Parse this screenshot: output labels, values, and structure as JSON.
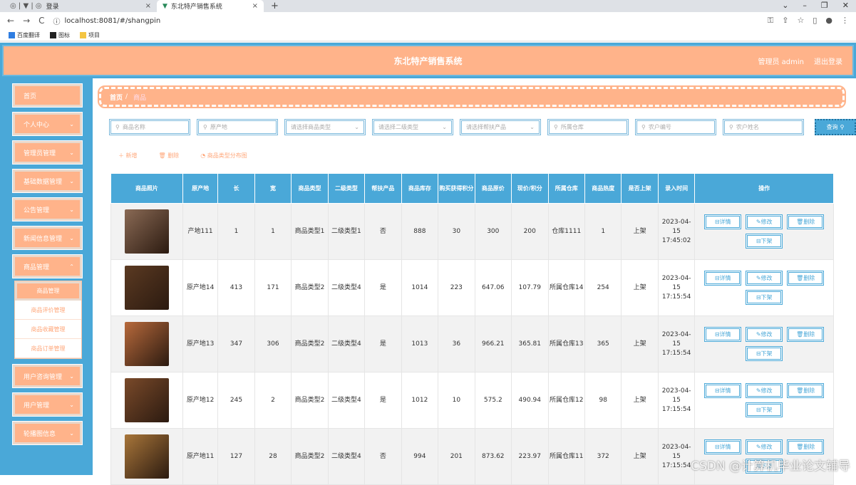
{
  "browser": {
    "tabs": [
      {
        "title": "登录"
      },
      {
        "title": "东北特产销售系统"
      }
    ],
    "url": "localhost:8081/#/shangpin",
    "bookmarks": [
      {
        "label": "百度翻译"
      },
      {
        "label": "图标"
      },
      {
        "label": "项目"
      }
    ]
  },
  "header": {
    "title": "东北特产销售系统",
    "user": "管理员 admin",
    "logout": "退出登录"
  },
  "sidebar": {
    "items": [
      {
        "label": "首页"
      },
      {
        "label": "个人中心"
      },
      {
        "label": "管理员管理"
      },
      {
        "label": "基础数据管理"
      },
      {
        "label": "公告管理"
      },
      {
        "label": "新闻信息管理"
      },
      {
        "label": "商品管理"
      }
    ],
    "submenu": [
      {
        "label": "商品管理"
      },
      {
        "label": "商品评价管理"
      },
      {
        "label": "商品收藏管理"
      },
      {
        "label": "商品订单管理"
      }
    ],
    "items_after": [
      {
        "label": "用户咨询管理"
      },
      {
        "label": "用户管理"
      },
      {
        "label": "轮播图信息"
      }
    ]
  },
  "breadcrumb": {
    "home": "首页",
    "sep": "/",
    "current": "商品"
  },
  "filters": {
    "name": "商品名称",
    "origin": "原产地",
    "type1": "请选择商品类型",
    "type2": "请选择二级类型",
    "help": "请选择帮扶产品",
    "warehouse": "所属仓库",
    "farmer_no": "农户编号",
    "farmer_name": "农户姓名",
    "query": "查询"
  },
  "toolbar": {
    "add": "新增",
    "delete": "删除",
    "chart": "商品类型分布图"
  },
  "table": {
    "headers": [
      "商品照片",
      "原产地",
      "长",
      "宽",
      "商品类型",
      "二级类型",
      "帮扶产品",
      "商品库存",
      "购买获得积分",
      "商品原价",
      "现价/积分",
      "所属仓库",
      "商品热度",
      "是否上架",
      "录入时间",
      "操作"
    ],
    "ops": {
      "detail": "详情",
      "edit": "修改",
      "delete": "删除",
      "off": "下架"
    },
    "rows": [
      {
        "origin": "产地111",
        "length": "1",
        "width": "1",
        "type1": "商品类型1",
        "type2": "二级类型1",
        "help": "否",
        "stock": "888",
        "points": "30",
        "orig_price": "300",
        "price": "200",
        "warehouse": "仓库1111",
        "heat": "1",
        "status": "上架",
        "time": "2023-04-15 17:45:02",
        "photo_color": "#8a6a55"
      },
      {
        "origin": "原产地14",
        "length": "413",
        "width": "171",
        "type1": "商品类型2",
        "type2": "二级类型4",
        "help": "是",
        "stock": "1014",
        "points": "223",
        "orig_price": "647.06",
        "price": "107.79",
        "warehouse": "所属仓库14",
        "heat": "254",
        "status": "上架",
        "time": "2023-04-15 17:15:54",
        "photo_color": "#5b3a22"
      },
      {
        "origin": "原产地13",
        "length": "347",
        "width": "306",
        "type1": "商品类型2",
        "type2": "二级类型4",
        "help": "是",
        "stock": "1013",
        "points": "36",
        "orig_price": "966.21",
        "price": "365.81",
        "warehouse": "所属仓库13",
        "heat": "365",
        "status": "上架",
        "time": "2023-04-15 17:15:54",
        "photo_color": "#b86a3c"
      },
      {
        "origin": "原产地12",
        "length": "245",
        "width": "2",
        "type1": "商品类型2",
        "type2": "二级类型4",
        "help": "是",
        "stock": "1012",
        "points": "10",
        "orig_price": "575.2",
        "price": "490.94",
        "warehouse": "所属仓库12",
        "heat": "98",
        "status": "上架",
        "time": "2023-04-15 17:15:54",
        "photo_color": "#7a4a2a"
      },
      {
        "origin": "原产地11",
        "length": "127",
        "width": "28",
        "type1": "商品类型2",
        "type2": "二级类型4",
        "help": "否",
        "stock": "994",
        "points": "201",
        "orig_price": "873.62",
        "price": "223.97",
        "warehouse": "所属仓库11",
        "heat": "372",
        "status": "上架",
        "time": "2023-04-15 17:15:54",
        "photo_color": "#a8763a"
      }
    ]
  },
  "watermark": "CSDN @计算机毕业论文辅导"
}
